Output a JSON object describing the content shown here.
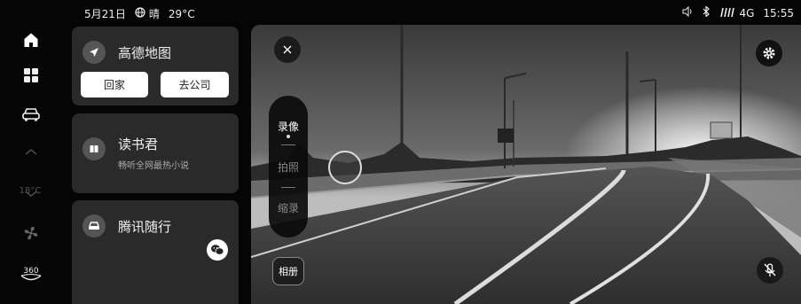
{
  "status": {
    "date": "5月21日",
    "weather": "晴",
    "temperature": "29°C",
    "network": "4G",
    "time": "15:55"
  },
  "rail": {
    "items": [
      {
        "name": "home",
        "icon": "home-icon"
      },
      {
        "name": "apps",
        "icon": "grid-icon"
      },
      {
        "name": "car",
        "icon": "car-icon"
      },
      {
        "name": "fan",
        "icon": "fan-icon"
      },
      {
        "name": "360",
        "icon": "360-icon",
        "label": "360"
      }
    ],
    "temperature": "18°C"
  },
  "cards": {
    "map": {
      "title": "高德地图",
      "home_label": "回家",
      "company_label": "去公司"
    },
    "reader": {
      "title": "读书君",
      "subtitle": "畅听全网最热小说"
    },
    "travel": {
      "title": "腾讯随行"
    }
  },
  "camera": {
    "modes": [
      "录像",
      "拍照",
      "缩录"
    ],
    "active_mode": "录像",
    "album_label": "相册"
  }
}
